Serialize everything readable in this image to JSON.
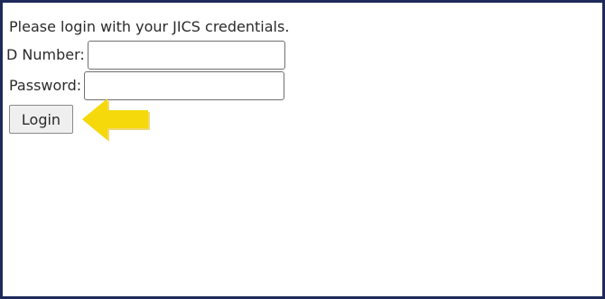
{
  "login_form": {
    "intro_text": "Please login with your JICS credentials.",
    "id_label": "D Number:",
    "id_value": "",
    "password_label": "Password:",
    "password_value": "",
    "login_button_label": "Login"
  },
  "annotation": {
    "arrow_icon": "left-arrow-icon",
    "arrow_color": "#f5d90a",
    "arrow_shadow": "#e6b800"
  },
  "colors": {
    "frame_border": "#1f2a5a",
    "text": "#2b2b2b",
    "button_bg": "#efefef"
  }
}
